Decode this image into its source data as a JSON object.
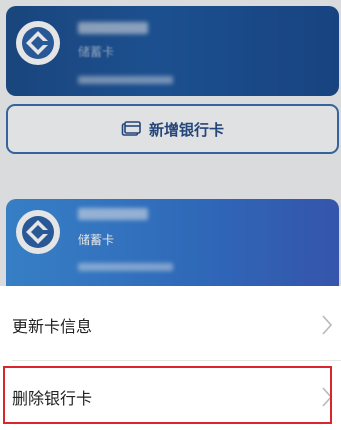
{
  "cards": [
    {
      "bank_logo": "bank-logo-icon",
      "card_type": "储蓄卡"
    },
    {
      "bank_logo": "bank-logo-icon",
      "card_type": "储蓄卡"
    }
  ],
  "add_card": {
    "icon": "bank-card-icon",
    "label": "新增银行卡"
  },
  "sheet": {
    "items": [
      {
        "label": "更新卡信息",
        "icon": "chevron-right-icon"
      },
      {
        "label": "删除银行卡",
        "icon": "chevron-right-icon"
      }
    ]
  },
  "colors": {
    "card_top": "#1e4e8c",
    "card_bottom": "#3a86d6",
    "accent": "#2a4f88",
    "highlight": "#d9262c"
  }
}
